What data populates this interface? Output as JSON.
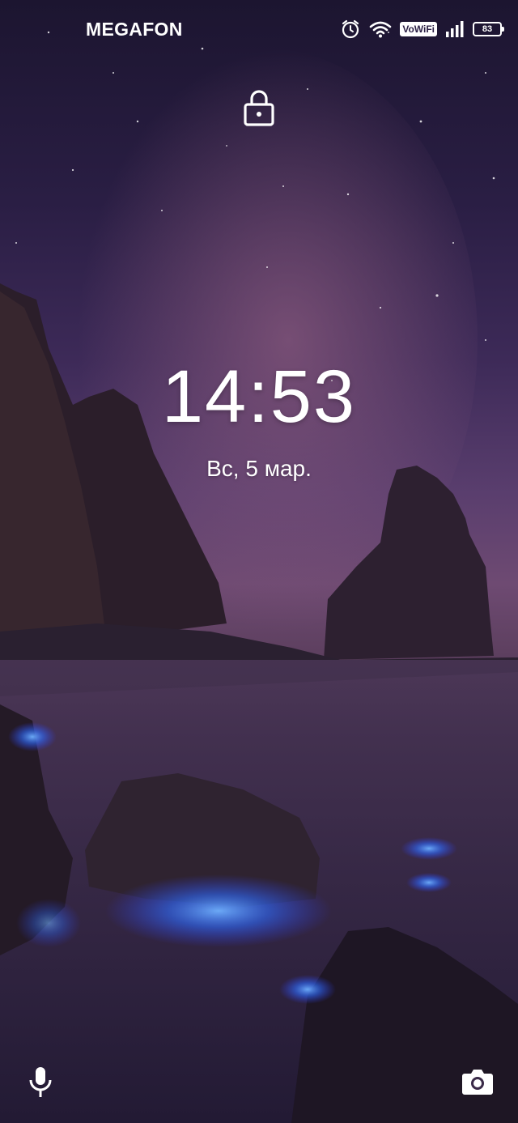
{
  "statusbar": {
    "carrier": "MEGAFON",
    "vowifi_label": "VoWiFi",
    "battery_level": "83",
    "icons": [
      "alarm-icon",
      "wifi-icon",
      "vowifi-badge",
      "signal-icon",
      "battery-icon"
    ]
  },
  "lockscreen": {
    "lock_icon": "lock-icon",
    "time": "14:53",
    "date": "Вс, 5 мар."
  },
  "shortcuts": {
    "left": "mic-icon",
    "right": "camera-icon"
  },
  "colors": {
    "sky_top": "#1c1530",
    "sky_mid": "#6e4a72",
    "water": "#2c2240",
    "glow": "#3a7bff",
    "text": "#ffffff"
  }
}
